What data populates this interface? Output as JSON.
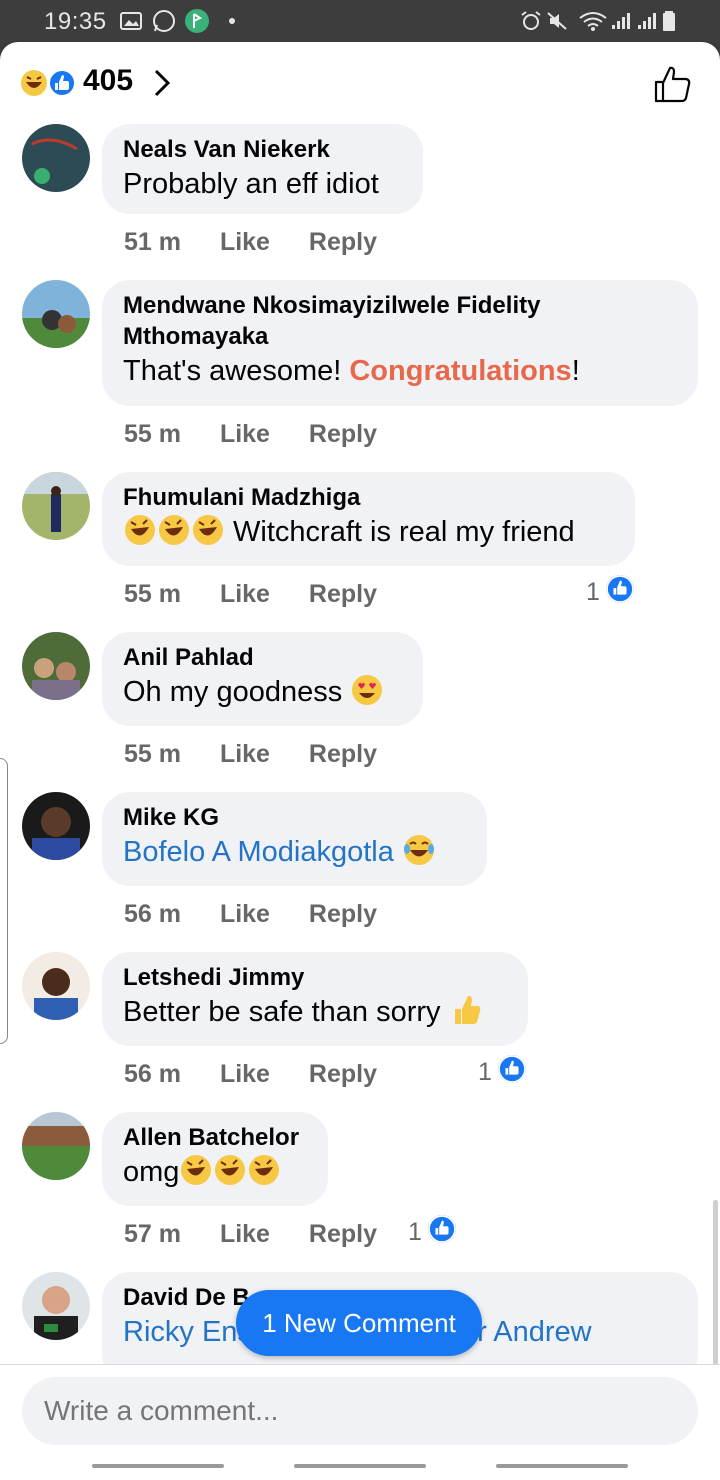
{
  "status_bar": {
    "time": "19:35",
    "icons": [
      "gallery-icon",
      "whatsapp-icon",
      "app-icon",
      "dot-icon",
      "alarm-icon",
      "mute-icon",
      "wifi-icon",
      "signal-icon",
      "signal-icon",
      "battery-icon"
    ]
  },
  "header": {
    "reaction_count": "405",
    "reactions": [
      "haha-icon",
      "like-icon"
    ]
  },
  "comments": [
    {
      "author": "Neals Van Niekerk",
      "text": "Probably an eff idiot",
      "time": "51 m",
      "like": "Like",
      "reply": "Reply",
      "likes": ""
    },
    {
      "author_line1": "Mendwane Nkosimayizilwele Fidelity",
      "author_line2": "Mthomayaka",
      "text_before": "That's awesome! ",
      "text_highlight": "Congratulations",
      "text_after": "!",
      "time": "55 m",
      "like": "Like",
      "reply": "Reply",
      "likes": ""
    },
    {
      "author": "Fhumulani Madzhiga",
      "text": " Witchcraft is real my friend",
      "time": "55 m",
      "like": "Like",
      "reply": "Reply",
      "likes": "1"
    },
    {
      "author": "Anil Pahlad",
      "text": "Oh my goodness ",
      "time": "55 m",
      "like": "Like",
      "reply": "Reply",
      "likes": ""
    },
    {
      "author": "Mike KG",
      "text": "Bofelo A Modiakgotla ",
      "time": "56 m",
      "like": "Like",
      "reply": "Reply",
      "likes": ""
    },
    {
      "author": "Letshedi Jimmy",
      "text": "Better be safe than sorry ",
      "time": "56 m",
      "like": "Like",
      "reply": "Reply",
      "likes": "1"
    },
    {
      "author": "Allen Batchelor",
      "text": "omg",
      "time": "57 m",
      "like": "Like",
      "reply": "Reply",
      "likes": "1"
    },
    {
      "author": "David De B",
      "text_left": "Ricky Ens",
      "text_right": "or Andrew"
    }
  ],
  "new_comment": "1 New Comment",
  "composer": {
    "placeholder": "Write a comment..."
  },
  "colors": {
    "accent": "#1877f2",
    "bubble": "#f0f2f5",
    "highlight": "#e8684c",
    "link": "#2374c6"
  }
}
